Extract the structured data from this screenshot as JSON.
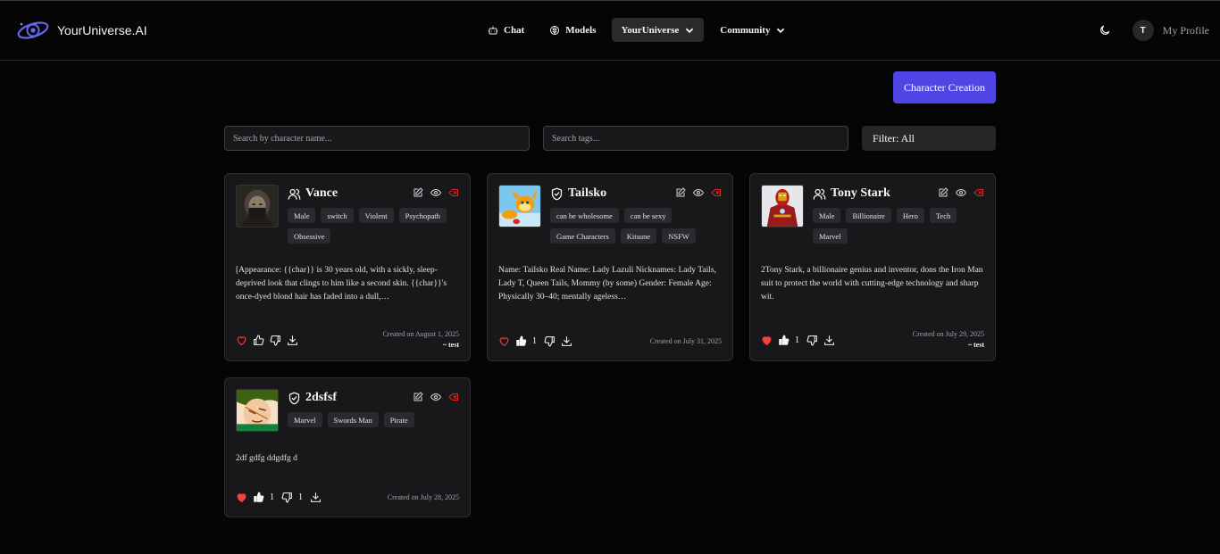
{
  "brand": {
    "name": "YourUniverse.AI"
  },
  "nav": [
    {
      "label": "Chat",
      "icon": "bot-icon"
    },
    {
      "label": "Models",
      "icon": "brain-icon"
    },
    {
      "label": "YourUniverse",
      "icon": "chevron-down-icon",
      "active": true
    },
    {
      "label": "Community",
      "icon": "chevron-down-icon"
    }
  ],
  "header": {
    "avatar_initial": "T",
    "profile_label": "My Profile",
    "theme_icon": "moon-icon"
  },
  "create_button": {
    "label": "Character Creation"
  },
  "search": {
    "name_placeholder": "Search by character name...",
    "tags_placeholder": "Search tags...",
    "filter_label": "Filter: All"
  },
  "colors": {
    "accent": "#4f46e5",
    "card_bg": "#18181b",
    "page_bg": "#050505",
    "heart": "#ef4444",
    "delete": "#dc2626"
  },
  "cards": [
    {
      "name": "Vance",
      "type_icon": "users-icon",
      "tags": [
        "Male",
        "switch",
        "Violent",
        "Psychopath",
        "Obsessive"
      ],
      "description": "[Appearance: {{char}} is 30 years old, with a sickly, sleep-deprived look that clings to him like a second skin. {{char}}'s once-dyed blond hair has faded into a dull,…",
      "liked": false,
      "likes": "",
      "dislikes": "",
      "created": "Created on August 1, 2025",
      "author": "~ test"
    },
    {
      "name": "Tailsko",
      "type_icon": "shield-check-icon",
      "tags": [
        "can be wholesome",
        "can be sexy",
        "Game Characters",
        "Kitsune",
        "NSFW"
      ],
      "description": "Name: Tailsko Real Name: Lady Lazuli Nicknames: Lady Tails, Lady T, Queen Tails, Mommy (by some) Gender: Female Age: Physically 30–40; mentally ageless…",
      "liked": false,
      "likes": "1",
      "dislikes": "",
      "created": "Created on July 31, 2025",
      "author": ""
    },
    {
      "name": "Tony Stark",
      "type_icon": "users-icon",
      "tags": [
        "Male",
        "Billionaire",
        "Hero",
        "Tech",
        "Marvel"
      ],
      "description": "2Tony Stark, a billionaire genius and inventor, dons the Iron Man suit to protect the world with cutting-edge technology and sharp wit.",
      "liked": true,
      "likes": "1",
      "dislikes": "",
      "created": "Created on July 29, 2025",
      "author": "~ test"
    },
    {
      "name": "2dsfsf",
      "type_icon": "shield-check-icon",
      "tags": [
        "Marvel",
        "Swords Man",
        "Pirate"
      ],
      "description": "2df gdfg ddgdfg d",
      "liked": true,
      "likes": "1",
      "dislikes": "1",
      "created": "Created on July 28, 2025",
      "author": ""
    }
  ]
}
